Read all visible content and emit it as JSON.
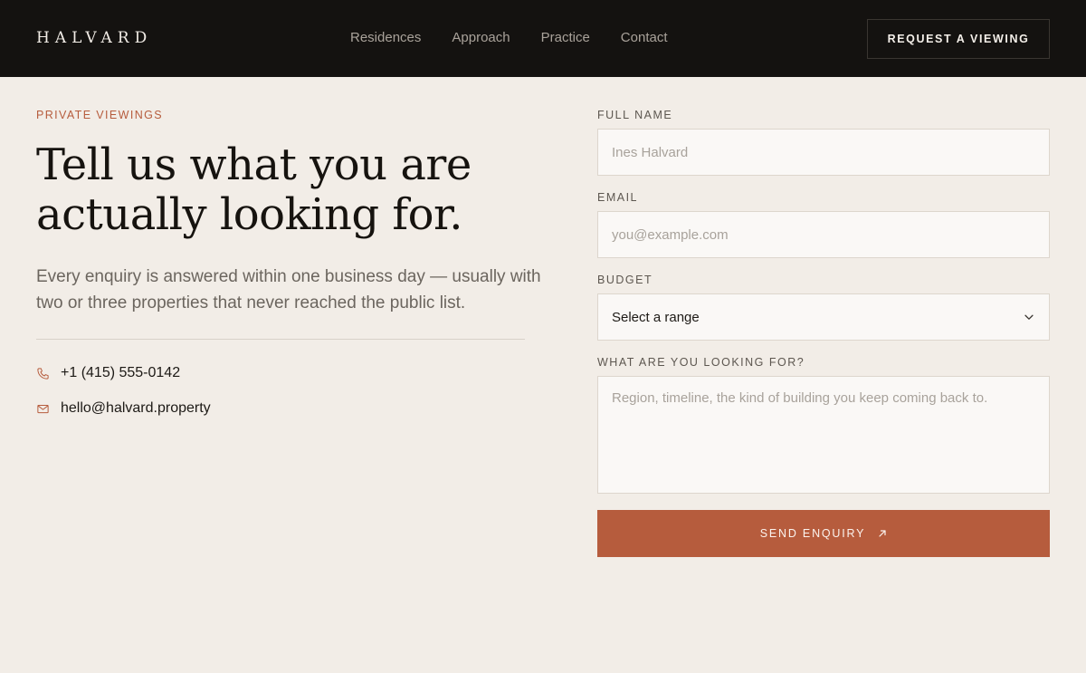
{
  "header": {
    "logo": "HALVARD",
    "nav": [
      "Residences",
      "Approach",
      "Practice",
      "Contact"
    ],
    "cta_label": "REQUEST A VIEWING"
  },
  "intro": {
    "eyebrow": "PRIVATE VIEWINGS",
    "headline_line1": "Tell us what you are",
    "headline_line2": "actually looking for.",
    "lede": "Every enquiry is answered within one business day — usually with two or three properties that never reached the public list.",
    "phone": "+1 (415) 555-0142",
    "email": "hello@halvard.property",
    "phone_icon": "phone-icon",
    "mail_icon": "mail-icon"
  },
  "form": {
    "name_label": "FULL NAME",
    "name_placeholder": "Ines Halvard",
    "email_label": "EMAIL",
    "email_placeholder": "you@example.com",
    "budget_label": "BUDGET",
    "budget_value": "Select a range",
    "looking_label": "WHAT ARE YOU LOOKING FOR?",
    "looking_placeholder": "Region, timeline, the kind of building you keep coming back to.",
    "submit_label": "SEND ENQUIRY",
    "submit_icon": "arrow-up-right-icon",
    "select_icon": "chevron-down-icon"
  },
  "colors": {
    "header_bg": "#141210",
    "page_bg": "#f2ede7",
    "accent": "#b65c3d"
  }
}
